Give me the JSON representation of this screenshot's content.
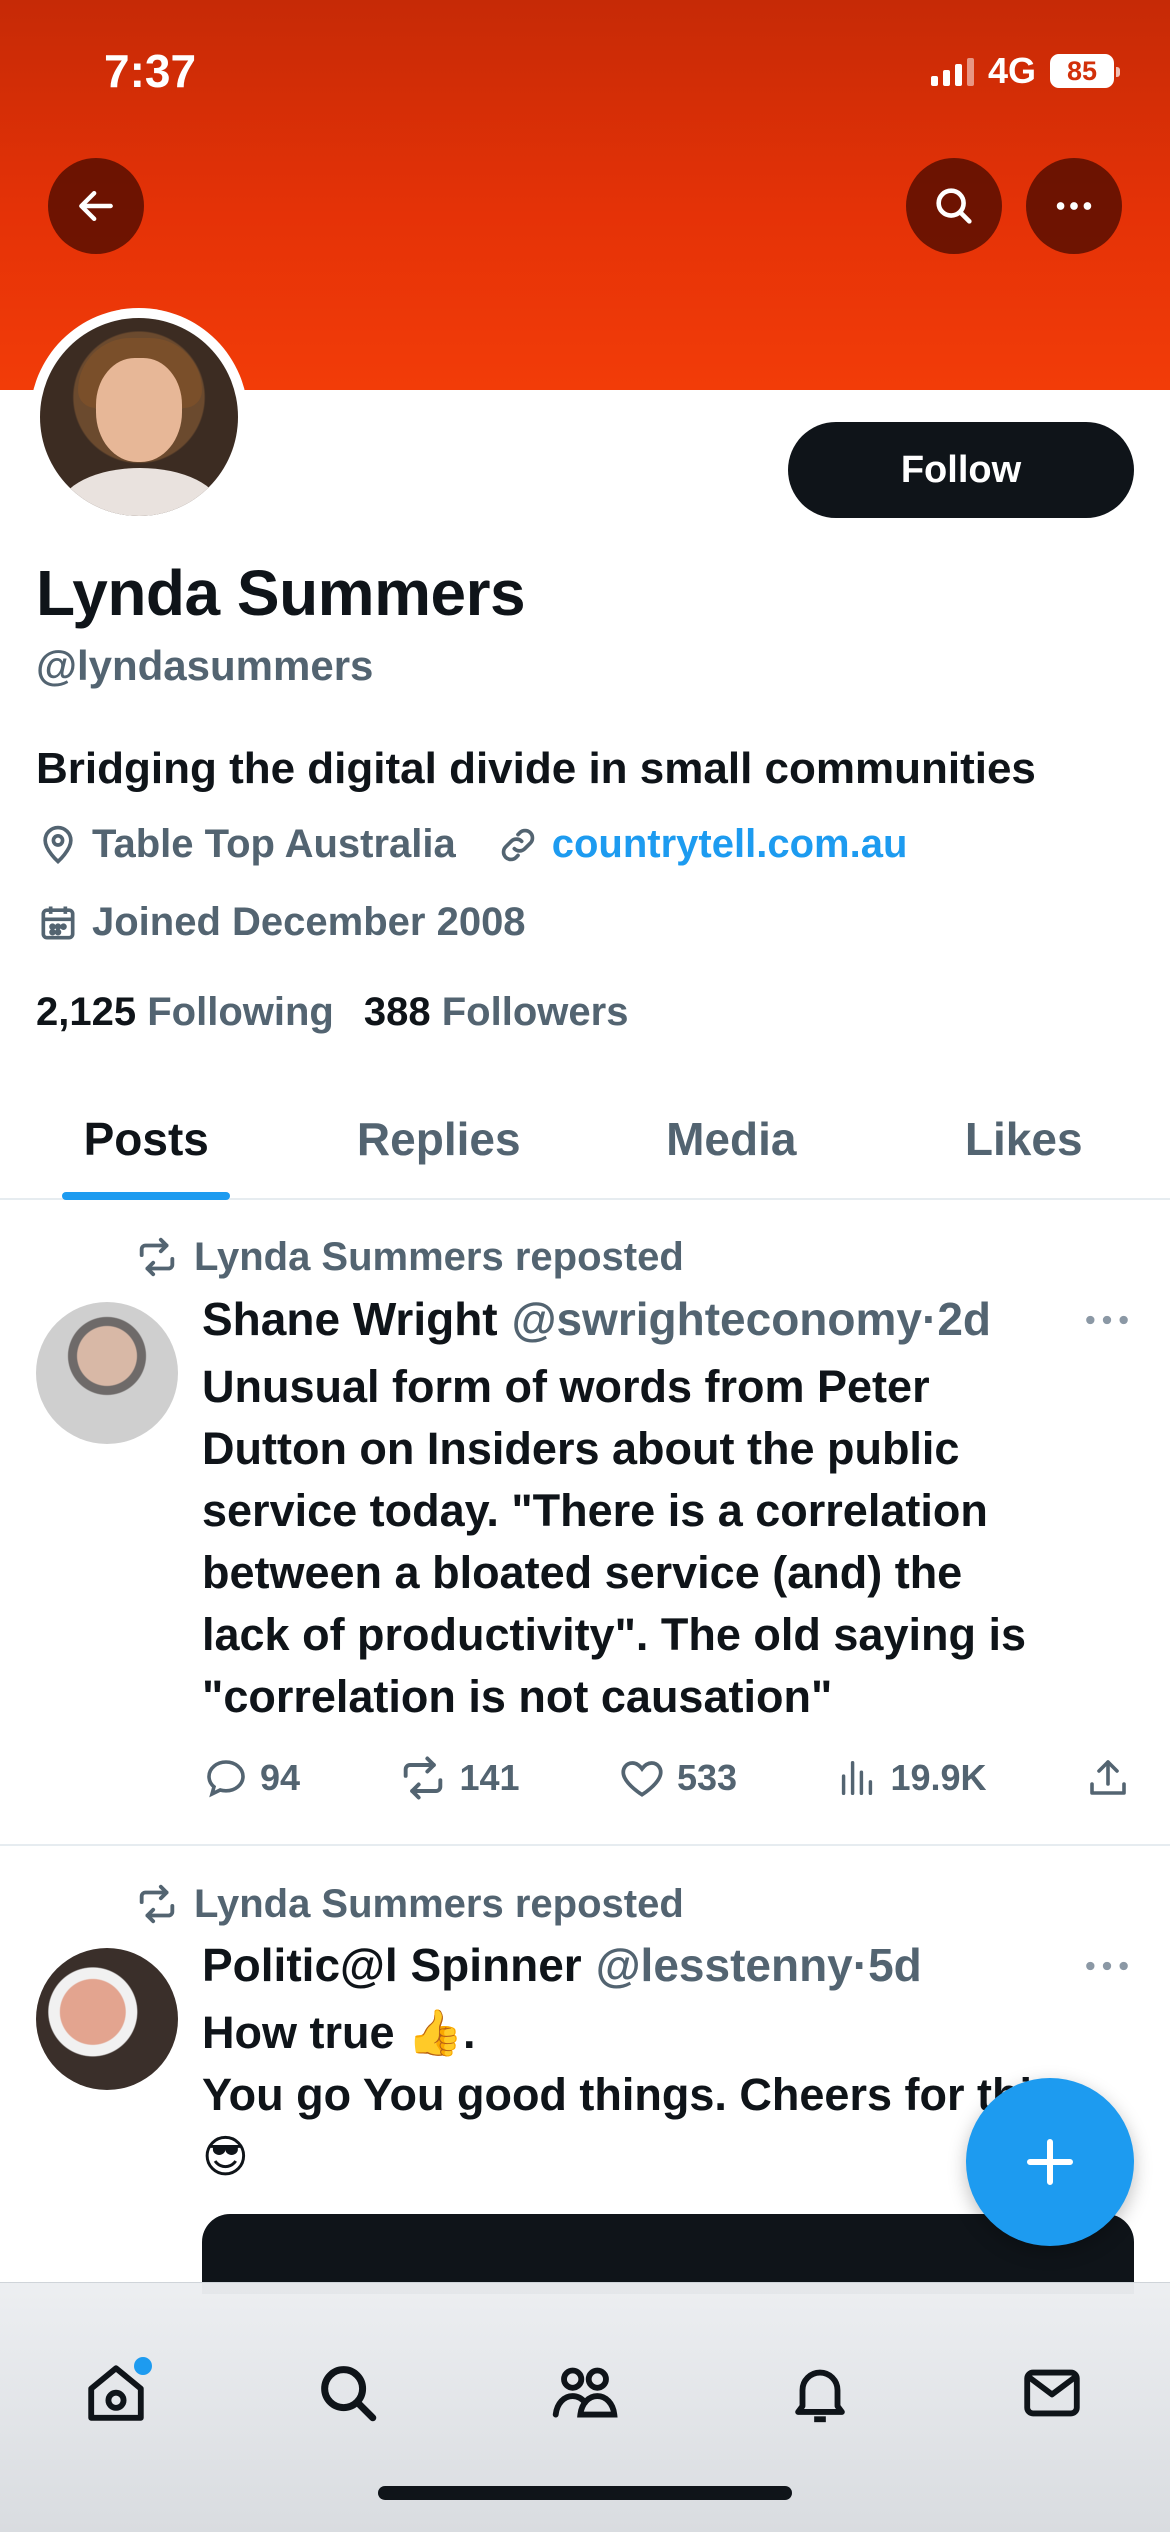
{
  "status_bar": {
    "time": "7:37",
    "network": "4G",
    "battery": "85"
  },
  "header": {
    "back_icon": "arrow-left-icon",
    "search_icon": "search-icon",
    "more_icon": "more-horizontal-icon",
    "banner_color": "#e53207"
  },
  "profile": {
    "display_name": "Lynda Summers",
    "handle": "@lyndasummers",
    "follow_label": "Follow",
    "bio": "Bridging the digital divide in small communities",
    "location": "Table Top Australia",
    "website": "countrytell.com.au",
    "joined": "Joined December 2008",
    "following_count": "2,125",
    "following_label": "Following",
    "followers_count": "388",
    "followers_label": "Followers"
  },
  "tabs": [
    {
      "label": "Posts",
      "active": true
    },
    {
      "label": "Replies",
      "active": false
    },
    {
      "label": "Media",
      "active": false
    },
    {
      "label": "Likes",
      "active": false
    }
  ],
  "posts": [
    {
      "repost_label": "Lynda Summers reposted",
      "author_name": "Shane Wright",
      "author_handle": "@swrighteconomy",
      "separator": "·",
      "time": "2d",
      "lines": [
        "Unusual form of words from Peter",
        "Dutton on Insiders about the public",
        "service today. \"There is a correlation",
        "between a bloated service (and) the",
        "lack of productivity\". The old saying is",
        "\"correlation is not causation\""
      ],
      "replies": "94",
      "reposts": "141",
      "likes": "533",
      "views": "19.9K"
    },
    {
      "repost_label": "Lynda Summers reposted",
      "author_name": "Politic@l Spinner",
      "author_handle": "@lesstenny",
      "separator": "·",
      "time": "5d",
      "line1": "How true 👍.",
      "line2": "You go You good things. Cheers for this",
      "line3": "😎"
    }
  ],
  "fab_icon": "plus-icon",
  "bottom_nav": [
    {
      "icon": "home-icon"
    },
    {
      "icon": "search-icon"
    },
    {
      "icon": "communities-icon"
    },
    {
      "icon": "bell-icon"
    },
    {
      "icon": "mail-icon"
    }
  ]
}
